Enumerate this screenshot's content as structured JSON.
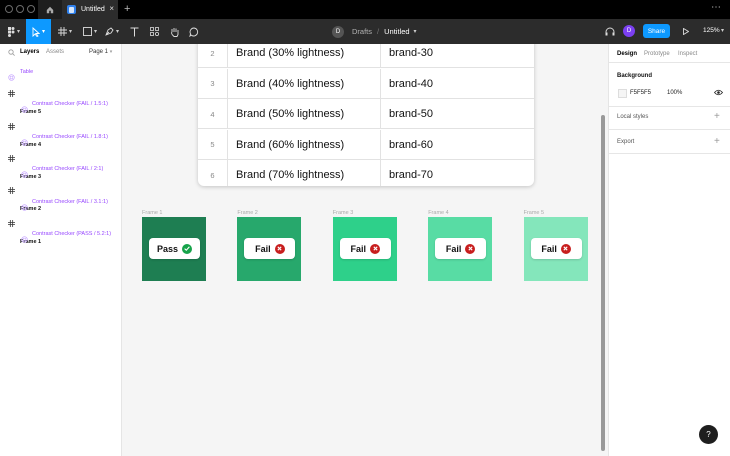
{
  "window": {
    "tab_title": "Untitled",
    "tab_close": "×",
    "new_tab": "+",
    "menu": "⋯"
  },
  "toolbar": {
    "breadcrumb": {
      "avatar": "D",
      "location": "Drafts",
      "separator": "/",
      "file": "Untitled"
    },
    "user_avatar": "D",
    "share_label": "Share",
    "zoom": "125%"
  },
  "left_panel": {
    "tabs": {
      "layers": "Layers",
      "assets": "Assets"
    },
    "page": "Page 1",
    "layers": [
      {
        "type": "table",
        "label": "Table"
      },
      {
        "type": "frame",
        "label": "Frame 5"
      },
      {
        "type": "comp",
        "label": "Contrast Checker (FAIL / 1.5:1)"
      },
      {
        "type": "frame",
        "label": "Frame 4"
      },
      {
        "type": "comp",
        "label": "Contrast Checker (FAIL / 1.8:1)"
      },
      {
        "type": "frame",
        "label": "Frame 3"
      },
      {
        "type": "comp",
        "label": "Contrast Checker (FAIL / 2:1)"
      },
      {
        "type": "frame",
        "label": "Frame 2"
      },
      {
        "type": "comp",
        "label": "Contrast Checker (FAIL / 3.1:1)"
      },
      {
        "type": "frame",
        "label": "Frame 1"
      },
      {
        "type": "comp",
        "label": "Contrast Checker (PASS / 5.2:1)"
      }
    ]
  },
  "right_panel": {
    "tabs": {
      "design": "Design",
      "prototype": "Prototype",
      "inspect": "Inspect"
    },
    "background": {
      "label": "Background",
      "hex": "F5F5F5",
      "opacity": "100%"
    },
    "local_styles": "Local styles",
    "export": "Export"
  },
  "canvas": {
    "table_rows": [
      {
        "num": "2",
        "name": "Brand (30% lightness)",
        "token": "brand-30"
      },
      {
        "num": "3",
        "name": "Brand (40% lightness)",
        "token": "brand-40"
      },
      {
        "num": "4",
        "name": "Brand (50% lightness)",
        "token": "brand-50"
      },
      {
        "num": "5",
        "name": "Brand (60% lightness)",
        "token": "brand-60"
      },
      {
        "num": "6",
        "name": "Brand (70% lightness)",
        "token": "brand-70"
      }
    ],
    "frames": [
      {
        "label": "Frame 1",
        "status": "Pass",
        "color": "#1e7e52"
      },
      {
        "label": "Frame 2",
        "status": "Fail",
        "color": "#27a86c"
      },
      {
        "label": "Frame 3",
        "status": "Fail",
        "color": "#2ed08a"
      },
      {
        "label": "Frame 4",
        "status": "Fail",
        "color": "#58dca4"
      },
      {
        "label": "Frame 5",
        "status": "Fail",
        "color": "#84e6bb"
      }
    ]
  },
  "help": "?",
  "colors": {
    "accent": "#0d99ff",
    "pass": "#16a34a",
    "fail": "#c81e1e",
    "component": "#9747ff"
  }
}
